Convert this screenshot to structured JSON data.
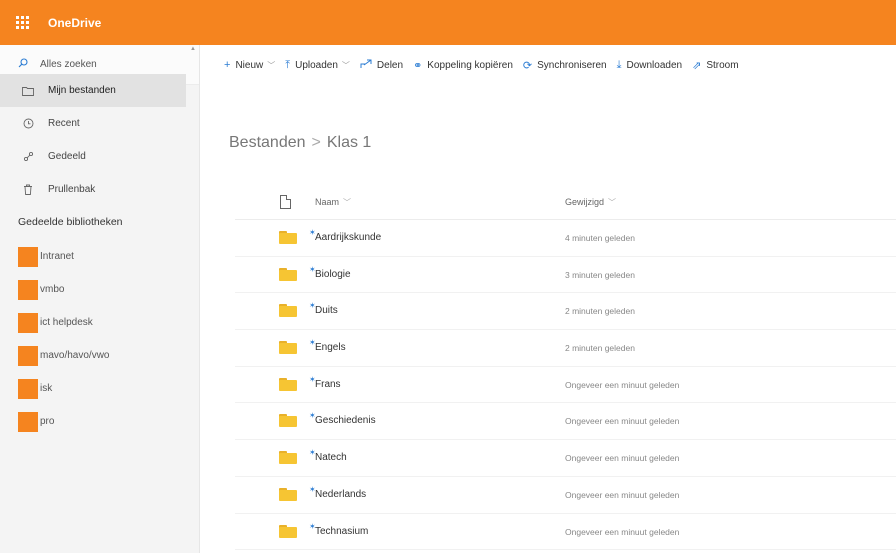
{
  "app": {
    "title": "OneDrive",
    "brand_color": "#f5841f"
  },
  "search": {
    "label": "Alles zoeken",
    "icon": "search-icon"
  },
  "nav": {
    "items": [
      {
        "label": "Mijn bestanden",
        "icon": "folder-icon",
        "active": true
      },
      {
        "label": "Recent",
        "icon": "clock-icon"
      },
      {
        "label": "Gedeeld",
        "icon": "share-icon"
      },
      {
        "label": "Prullenbak",
        "icon": "trash-icon"
      }
    ],
    "libraries_heading": "Gedeelde bibliotheken",
    "libraries": [
      {
        "label": "Intranet"
      },
      {
        "label": "vmbo"
      },
      {
        "label": "ict helpdesk"
      },
      {
        "label": "mavo/havo/vwo"
      },
      {
        "label": "isk"
      },
      {
        "label": "pro"
      }
    ]
  },
  "commands": [
    {
      "label": "Nieuw",
      "icon": "plus-icon",
      "dropdown": true
    },
    {
      "label": "Uploaden",
      "icon": "upload-icon",
      "dropdown": true
    },
    {
      "label": "Delen",
      "icon": "share-icon"
    },
    {
      "label": "Koppeling kopiëren",
      "icon": "link-icon"
    },
    {
      "label": "Synchroniseren",
      "icon": "sync-icon"
    },
    {
      "label": "Downloaden",
      "icon": "download-icon"
    },
    {
      "label": "Stroom",
      "icon": "flow-icon"
    }
  ],
  "breadcrumb": {
    "root": "Bestanden",
    "separator": ">",
    "current": "Klas 1"
  },
  "columns": {
    "name": "Naam",
    "modified": "Gewijzigd"
  },
  "files": [
    {
      "name": "Aardrijkskunde",
      "modified": "4 minuten geleden"
    },
    {
      "name": "Biologie",
      "modified": "3 minuten geleden"
    },
    {
      "name": "Duits",
      "modified": "2 minuten geleden"
    },
    {
      "name": "Engels",
      "modified": "2 minuten geleden"
    },
    {
      "name": "Frans",
      "modified": "Ongeveer een minuut geleden"
    },
    {
      "name": "Geschiedenis",
      "modified": "Ongeveer een minuut geleden"
    },
    {
      "name": "Natech",
      "modified": "Ongeveer een minuut geleden"
    },
    {
      "name": "Nederlands",
      "modified": "Ongeveer een minuut geleden"
    },
    {
      "name": "Technasium",
      "modified": "Ongeveer een minuut geleden"
    }
  ]
}
